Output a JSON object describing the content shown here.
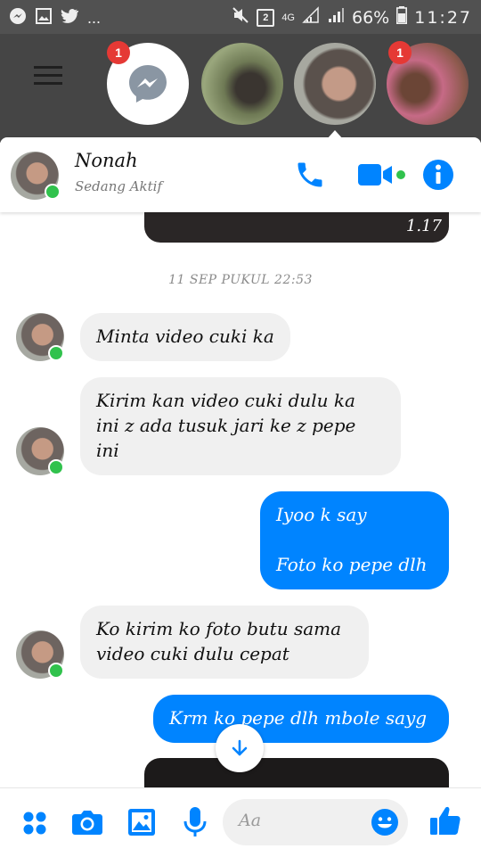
{
  "status_bar": {
    "battery_percent": "66%",
    "time": "11:27",
    "network": "4G",
    "sim_badge": "2",
    "overflow": "..."
  },
  "chat_heads": {
    "badge_messenger": "1",
    "badge_last": "1"
  },
  "header": {
    "name": "Nonah",
    "status": "Sedang Aktif"
  },
  "messages": {
    "media_duration": "1.17",
    "date_separator": "11 SEP PUKUL 22:53",
    "m1": "Minta video cuki ka",
    "m2": "Kirim kan video cuki dulu ka\nini z ada tusuk jari ke z pepe\nini",
    "m3": "Iyoo k say\n\nFoto ko pepe dlh",
    "m4": "Ko kirim ko foto butu sama\nvideo cuki dulu cepat",
    "m5": "Krm ko pepe dlh mbole sayg"
  },
  "composer": {
    "placeholder": "Aa"
  },
  "colors": {
    "accent": "#0084ff",
    "online": "#31c24d",
    "badge": "#e53935"
  }
}
